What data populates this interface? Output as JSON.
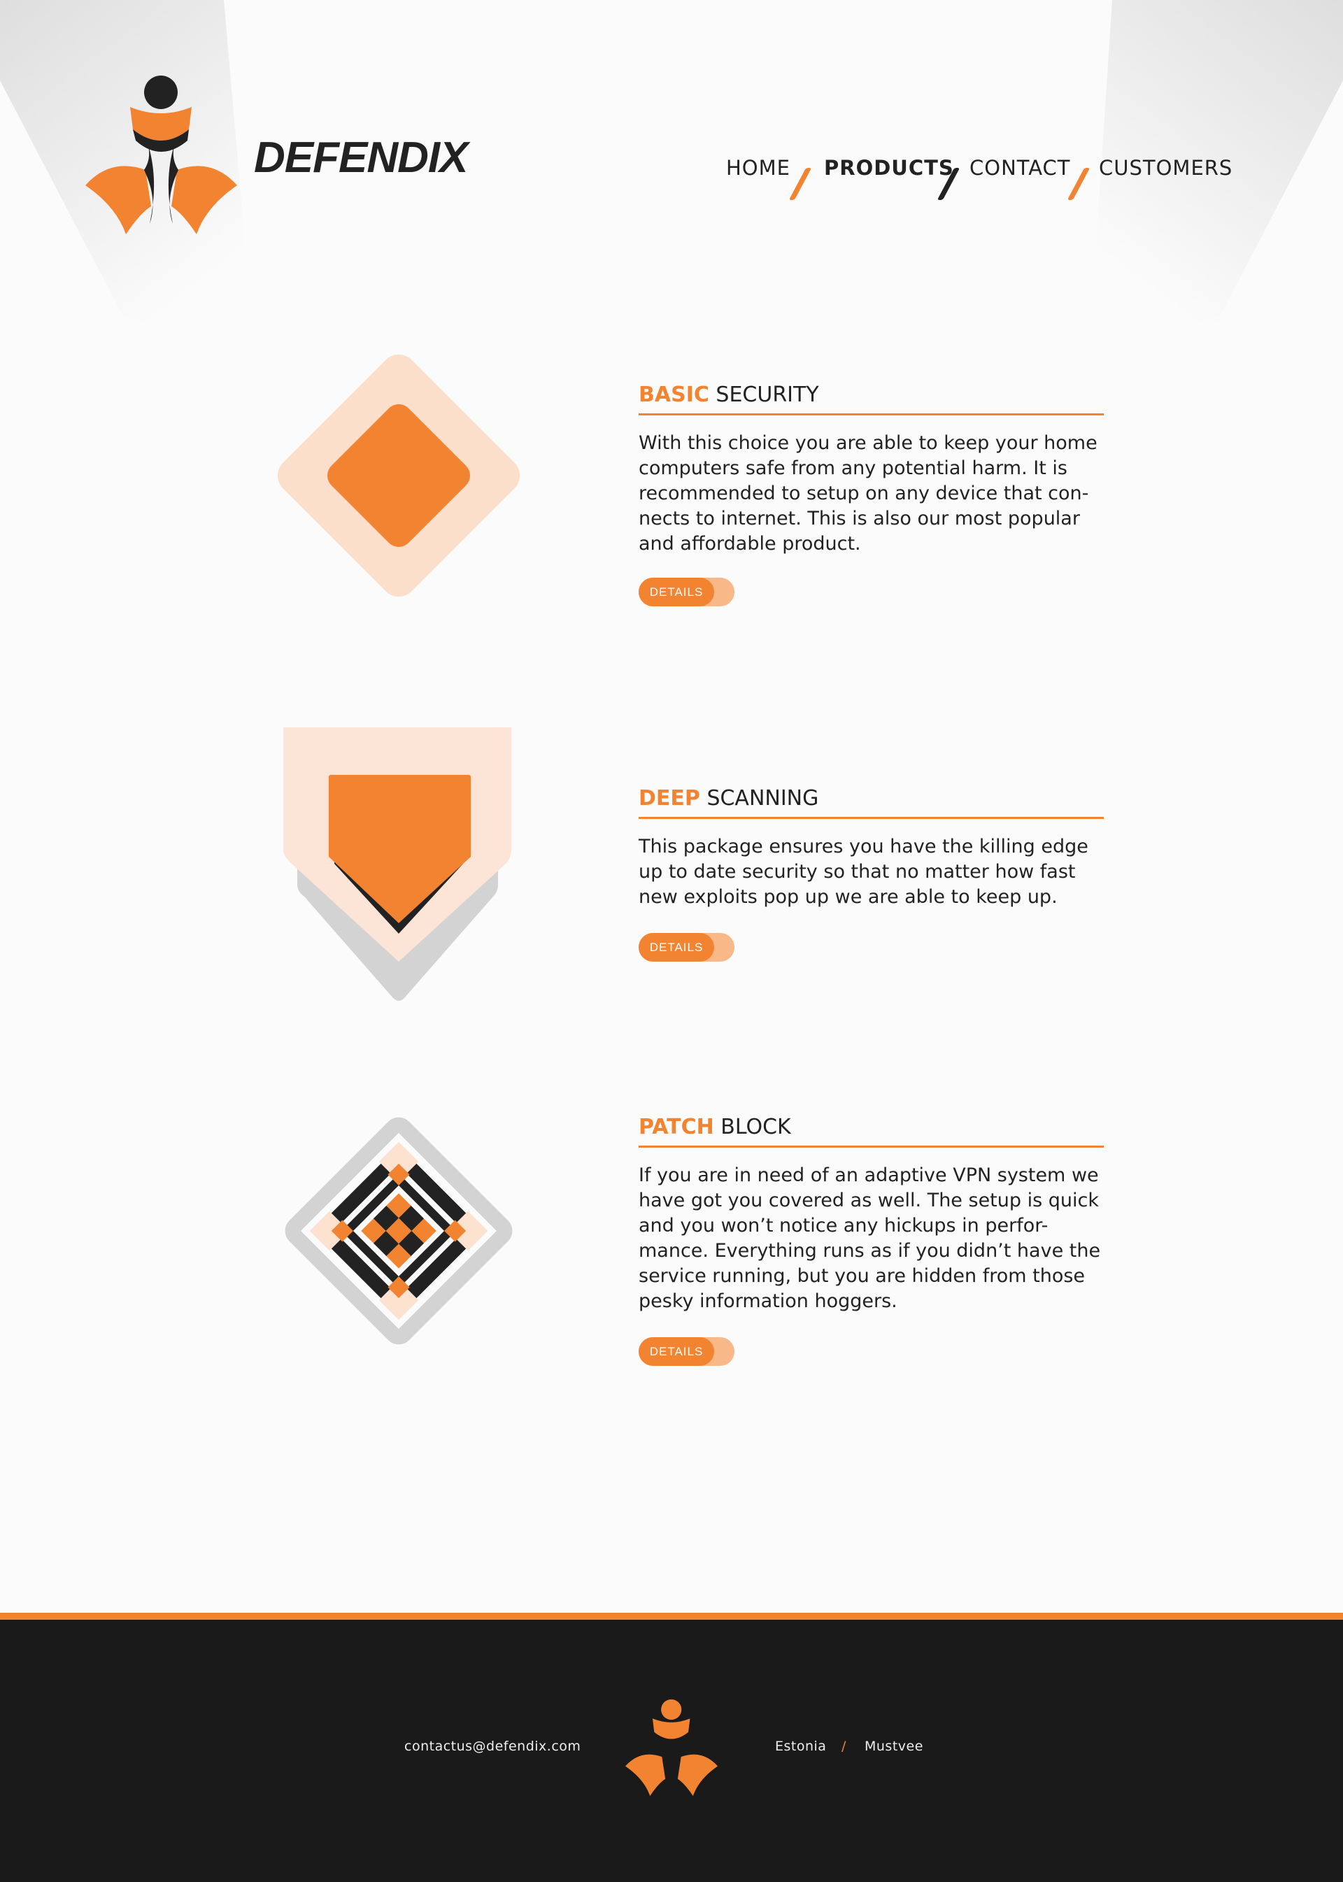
{
  "colors": {
    "accent": "#f28431",
    "accent_light": "#fbdfcb",
    "dark": "#222222",
    "footer_bg": "#1a1a1a"
  },
  "brand": {
    "name": "DEFENDIX",
    "logo_icon": "defendix-logo-icon"
  },
  "nav": {
    "items": [
      {
        "label": "HOME",
        "active": false
      },
      {
        "label": "PRODUCTS",
        "active": true
      },
      {
        "label": "CONTACT",
        "active": false
      },
      {
        "label": "CUSTOMERS",
        "active": false
      }
    ]
  },
  "products": [
    {
      "title_highlight": "BASIC",
      "title_rest": "SECURITY",
      "description": "With this choice you are able to keep your home computers safe from any potential harm. It is recommended to setup on any device that con-nects to internet. This is also our most popular and affordable product.",
      "button_label": "DETAILS",
      "icon": "diamond-icon"
    },
    {
      "title_highlight": "DEEP",
      "title_rest": "SCANNING",
      "description": "This package ensures you have the killing edge up to date security so that no matter how fast new exploits pop up we are able to keep up.",
      "button_label": "DETAILS",
      "icon": "shield-icon"
    },
    {
      "title_highlight": "PATCH",
      "title_rest": "BLOCK",
      "description": "If you are in need of an adaptive VPN system we have got you covered as well. The setup is quick and you won’t notice any hickups in perfor-mance. Everything runs as if you didn’t have the service running, but you are hidden from those pesky information hoggers.",
      "button_label": "DETAILS",
      "icon": "checkered-diamond-icon"
    }
  ],
  "footer": {
    "email": "contactus@defendix.com",
    "country": "Estonia",
    "separator": "/",
    "city": "Mustvee"
  }
}
